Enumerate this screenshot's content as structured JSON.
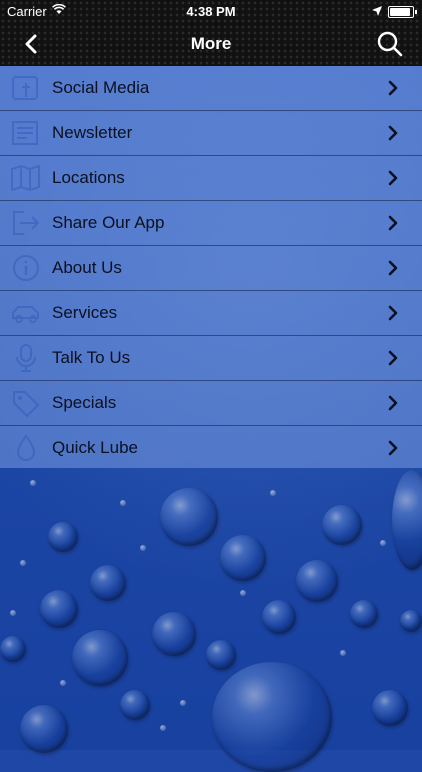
{
  "status_bar": {
    "carrier": "Carrier",
    "time": "4:38 PM"
  },
  "nav": {
    "title": "More",
    "back_icon": "chevron-left-icon",
    "search_icon": "search-icon"
  },
  "menu": {
    "items": [
      {
        "label": "Social Media",
        "icon": "social-icon"
      },
      {
        "label": "Newsletter",
        "icon": "newsletter-icon"
      },
      {
        "label": "Locations",
        "icon": "map-icon"
      },
      {
        "label": "Share Our App",
        "icon": "share-icon"
      },
      {
        "label": "About Us",
        "icon": "info-icon"
      },
      {
        "label": "Services",
        "icon": "car-icon"
      },
      {
        "label": "Talk To Us",
        "icon": "microphone-icon"
      },
      {
        "label": "Specials",
        "icon": "tag-icon"
      },
      {
        "label": "Quick Lube",
        "icon": "oil-icon"
      }
    ]
  },
  "colors": {
    "background": "#1f47a6",
    "menu_overlay": "#789be1",
    "topbar": "#111111",
    "text": "#0b1020"
  }
}
